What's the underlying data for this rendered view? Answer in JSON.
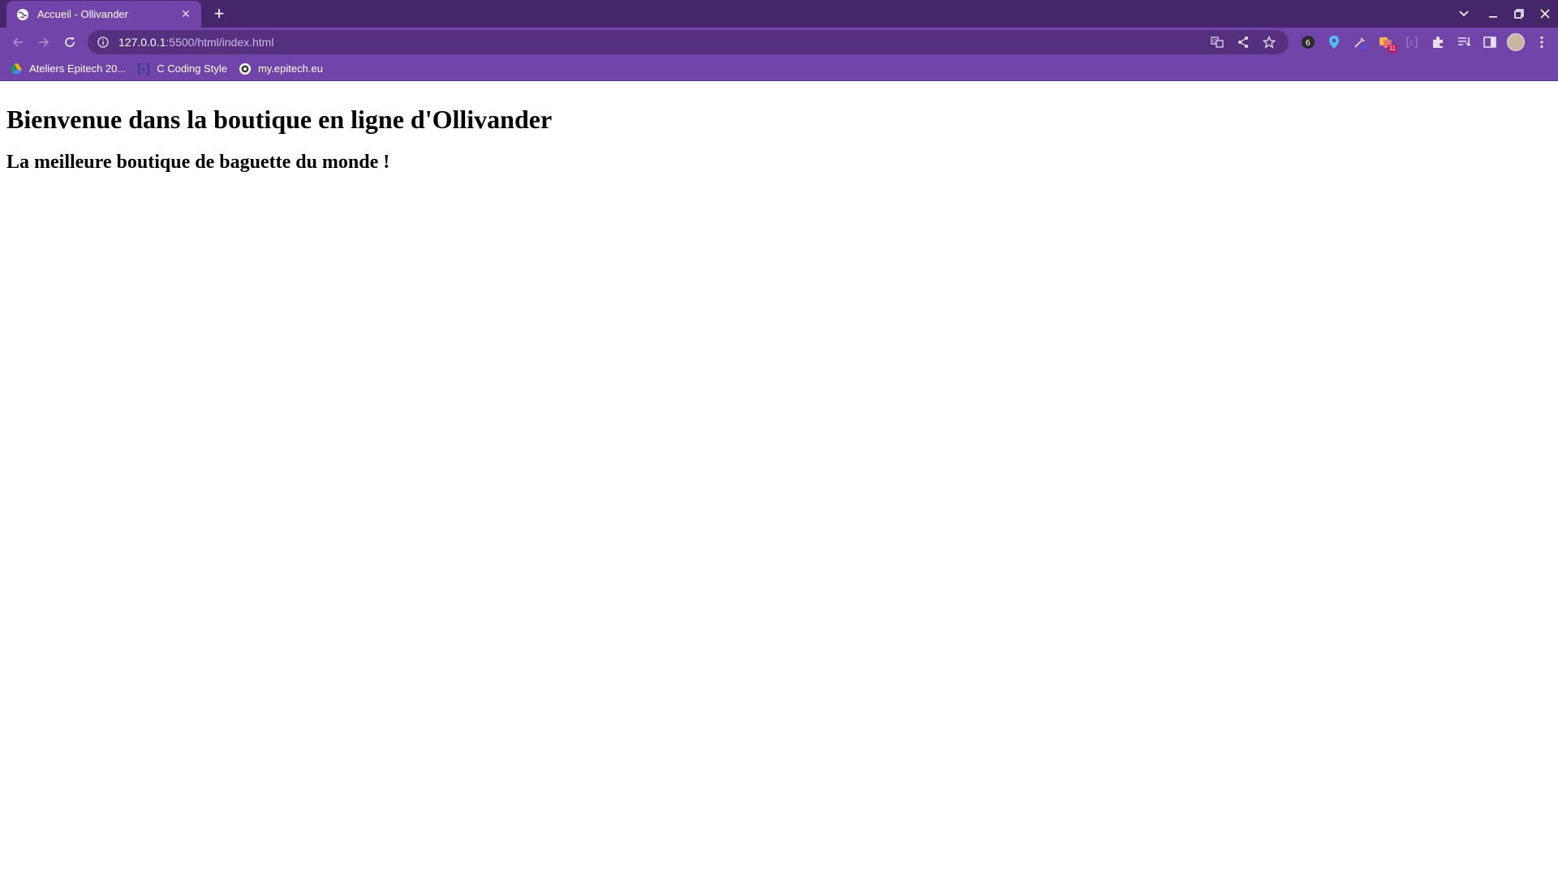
{
  "browser": {
    "tab_title": "Accueil - Ollivander",
    "url_host": "127.0.0.1",
    "url_path": ":5500/html/index.html",
    "extension_badge": "11",
    "bookmarks": [
      "Ateliers Epitech 20...",
      "C Coding Style",
      "my.epitech.eu"
    ],
    "icons": [
      "globe-icon",
      "close-icon",
      "plus-icon",
      "chevron-down-icon",
      "minimize-icon",
      "restore-icon",
      "window-close-icon",
      "back-icon",
      "forward-icon",
      "reload-icon",
      "info-icon",
      "translate-icon",
      "share-icon",
      "star-icon",
      "puzzle-icon",
      "reading-list-icon",
      "side-panel-icon",
      "menu-icon"
    ]
  },
  "page": {
    "heading": "Bienvenue dans la boutique en ligne d'Ollivander",
    "subheading": "La meilleure boutique de baguette du monde !"
  },
  "colors": {
    "frame": "#46266b",
    "toolbar": "#7044a8",
    "omnibox": "#55307f"
  }
}
